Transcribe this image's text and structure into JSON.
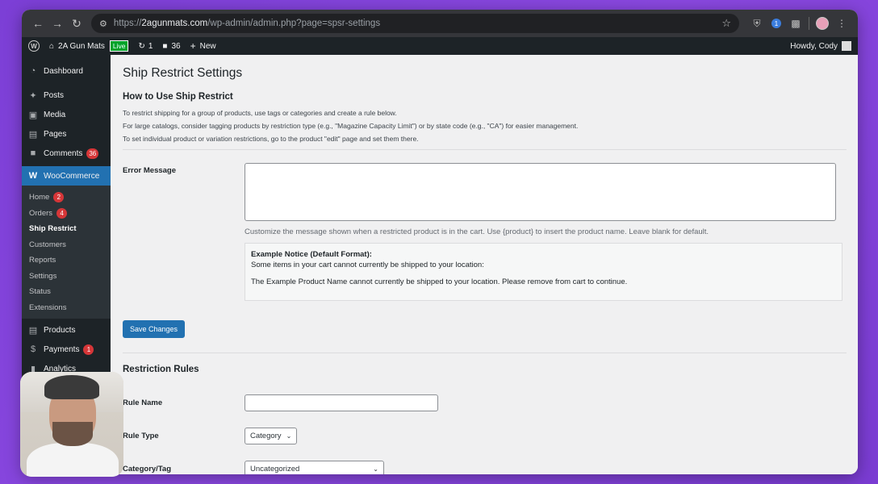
{
  "browser": {
    "url_scheme": "https://",
    "url_host": "2agunmats.com",
    "url_path": "/wp-admin/admin.php?page=spsr-settings"
  },
  "adminbar": {
    "site_name": "2A Gun Mats",
    "live_label": "Live",
    "updates_count": "1",
    "comments_count": "36",
    "new_label": "New",
    "howdy": "Howdy, Cody"
  },
  "sidebar": {
    "dashboard": "Dashboard",
    "posts": "Posts",
    "media": "Media",
    "pages": "Pages",
    "comments": "Comments",
    "comments_badge": "36",
    "woocommerce": "WooCommerce",
    "sub": {
      "home": "Home",
      "home_badge": "2",
      "orders": "Orders",
      "orders_badge": "4",
      "ship_restrict": "Ship Restrict",
      "customers": "Customers",
      "reports": "Reports",
      "settings": "Settings",
      "status": "Status",
      "extensions": "Extensions"
    },
    "products": "Products",
    "payments": "Payments",
    "payments_badge": "1",
    "analytics": "Analytics"
  },
  "main": {
    "page_title": "Ship Restrict Settings",
    "howto_title": "How to Use Ship Restrict",
    "help": [
      "To restrict shipping for a group of products, use tags or categories and create a rule below.",
      "For large catalogs, consider tagging products by restriction type (e.g., \"Magazine Capacity Limit\") or by state code (e.g., \"CA\") for easier management.",
      "To set individual product or variation restrictions, go to the product \"edit\" page and set them there."
    ],
    "error_message_label": "Error Message",
    "error_message_value": "",
    "error_desc": "Customize the message shown when a restricted product is in the cart. Use {product} to insert the product name. Leave blank for default.",
    "example_title": "Example Notice (Default Format):",
    "example_line1": "Some items in your cart cannot currently be shipped to your location:",
    "example_line2": "The Example Product Name cannot currently be shipped to your location. Please remove from cart to continue.",
    "save_button": "Save Changes",
    "restriction_title": "Restriction Rules",
    "rule_name_label": "Rule Name",
    "rule_name_value": "",
    "rule_type_label": "Rule Type",
    "rule_type_value": "Category",
    "category_tag_label": "Category/Tag",
    "category_tag_value": "Uncategorized"
  },
  "colors": {
    "accent": "#2271b1",
    "admin_dark": "#1d2327",
    "badge": "#d63638",
    "background": "#8a48e0"
  }
}
